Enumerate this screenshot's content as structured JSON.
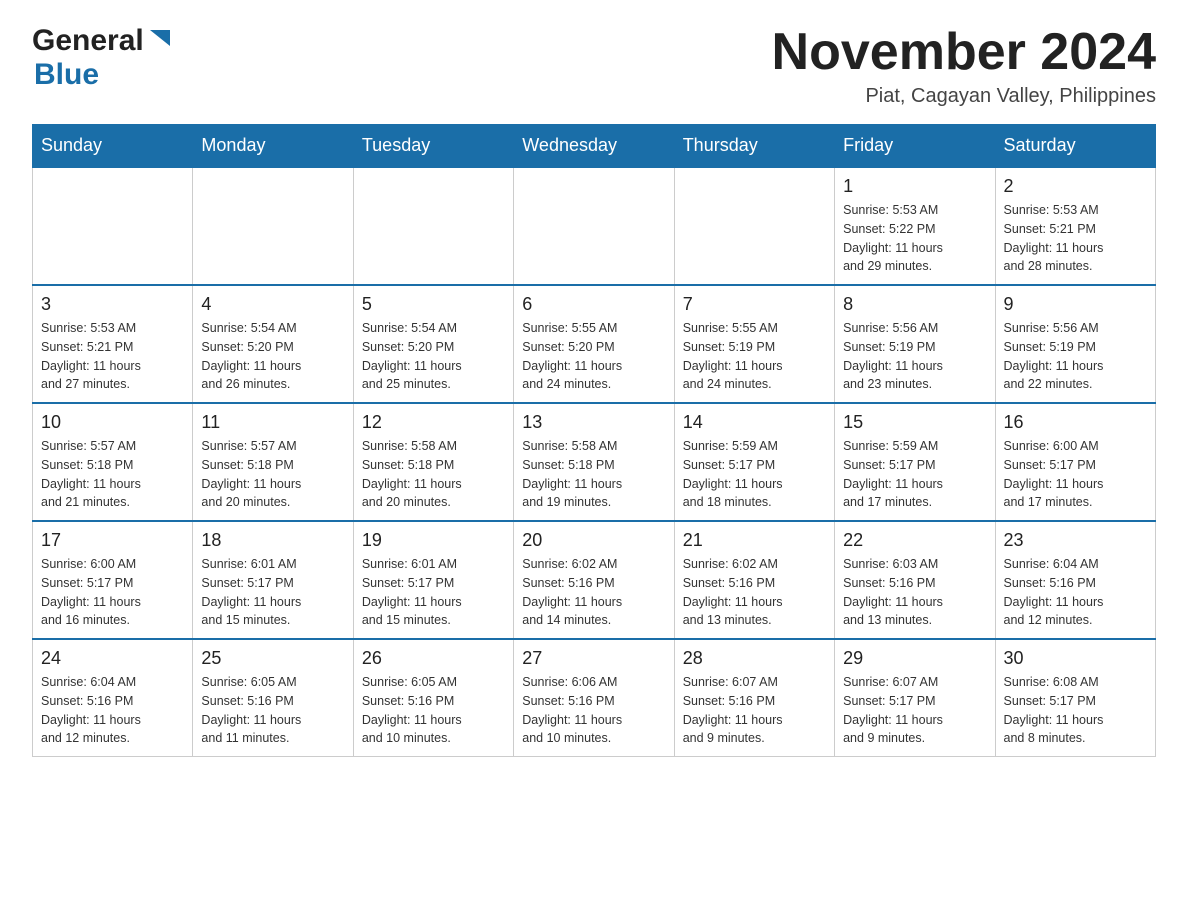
{
  "logo": {
    "general": "General",
    "blue": "Blue",
    "arrow_color": "#1a6ea8"
  },
  "title": "November 2024",
  "subtitle": "Piat, Cagayan Valley, Philippines",
  "weekdays": [
    "Sunday",
    "Monday",
    "Tuesday",
    "Wednesday",
    "Thursday",
    "Friday",
    "Saturday"
  ],
  "weeks": [
    [
      {
        "day": "",
        "info": ""
      },
      {
        "day": "",
        "info": ""
      },
      {
        "day": "",
        "info": ""
      },
      {
        "day": "",
        "info": ""
      },
      {
        "day": "",
        "info": ""
      },
      {
        "day": "1",
        "info": "Sunrise: 5:53 AM\nSunset: 5:22 PM\nDaylight: 11 hours\nand 29 minutes."
      },
      {
        "day": "2",
        "info": "Sunrise: 5:53 AM\nSunset: 5:21 PM\nDaylight: 11 hours\nand 28 minutes."
      }
    ],
    [
      {
        "day": "3",
        "info": "Sunrise: 5:53 AM\nSunset: 5:21 PM\nDaylight: 11 hours\nand 27 minutes."
      },
      {
        "day": "4",
        "info": "Sunrise: 5:54 AM\nSunset: 5:20 PM\nDaylight: 11 hours\nand 26 minutes."
      },
      {
        "day": "5",
        "info": "Sunrise: 5:54 AM\nSunset: 5:20 PM\nDaylight: 11 hours\nand 25 minutes."
      },
      {
        "day": "6",
        "info": "Sunrise: 5:55 AM\nSunset: 5:20 PM\nDaylight: 11 hours\nand 24 minutes."
      },
      {
        "day": "7",
        "info": "Sunrise: 5:55 AM\nSunset: 5:19 PM\nDaylight: 11 hours\nand 24 minutes."
      },
      {
        "day": "8",
        "info": "Sunrise: 5:56 AM\nSunset: 5:19 PM\nDaylight: 11 hours\nand 23 minutes."
      },
      {
        "day": "9",
        "info": "Sunrise: 5:56 AM\nSunset: 5:19 PM\nDaylight: 11 hours\nand 22 minutes."
      }
    ],
    [
      {
        "day": "10",
        "info": "Sunrise: 5:57 AM\nSunset: 5:18 PM\nDaylight: 11 hours\nand 21 minutes."
      },
      {
        "day": "11",
        "info": "Sunrise: 5:57 AM\nSunset: 5:18 PM\nDaylight: 11 hours\nand 20 minutes."
      },
      {
        "day": "12",
        "info": "Sunrise: 5:58 AM\nSunset: 5:18 PM\nDaylight: 11 hours\nand 20 minutes."
      },
      {
        "day": "13",
        "info": "Sunrise: 5:58 AM\nSunset: 5:18 PM\nDaylight: 11 hours\nand 19 minutes."
      },
      {
        "day": "14",
        "info": "Sunrise: 5:59 AM\nSunset: 5:17 PM\nDaylight: 11 hours\nand 18 minutes."
      },
      {
        "day": "15",
        "info": "Sunrise: 5:59 AM\nSunset: 5:17 PM\nDaylight: 11 hours\nand 17 minutes."
      },
      {
        "day": "16",
        "info": "Sunrise: 6:00 AM\nSunset: 5:17 PM\nDaylight: 11 hours\nand 17 minutes."
      }
    ],
    [
      {
        "day": "17",
        "info": "Sunrise: 6:00 AM\nSunset: 5:17 PM\nDaylight: 11 hours\nand 16 minutes."
      },
      {
        "day": "18",
        "info": "Sunrise: 6:01 AM\nSunset: 5:17 PM\nDaylight: 11 hours\nand 15 minutes."
      },
      {
        "day": "19",
        "info": "Sunrise: 6:01 AM\nSunset: 5:17 PM\nDaylight: 11 hours\nand 15 minutes."
      },
      {
        "day": "20",
        "info": "Sunrise: 6:02 AM\nSunset: 5:16 PM\nDaylight: 11 hours\nand 14 minutes."
      },
      {
        "day": "21",
        "info": "Sunrise: 6:02 AM\nSunset: 5:16 PM\nDaylight: 11 hours\nand 13 minutes."
      },
      {
        "day": "22",
        "info": "Sunrise: 6:03 AM\nSunset: 5:16 PM\nDaylight: 11 hours\nand 13 minutes."
      },
      {
        "day": "23",
        "info": "Sunrise: 6:04 AM\nSunset: 5:16 PM\nDaylight: 11 hours\nand 12 minutes."
      }
    ],
    [
      {
        "day": "24",
        "info": "Sunrise: 6:04 AM\nSunset: 5:16 PM\nDaylight: 11 hours\nand 12 minutes."
      },
      {
        "day": "25",
        "info": "Sunrise: 6:05 AM\nSunset: 5:16 PM\nDaylight: 11 hours\nand 11 minutes."
      },
      {
        "day": "26",
        "info": "Sunrise: 6:05 AM\nSunset: 5:16 PM\nDaylight: 11 hours\nand 10 minutes."
      },
      {
        "day": "27",
        "info": "Sunrise: 6:06 AM\nSunset: 5:16 PM\nDaylight: 11 hours\nand 10 minutes."
      },
      {
        "day": "28",
        "info": "Sunrise: 6:07 AM\nSunset: 5:16 PM\nDaylight: 11 hours\nand 9 minutes."
      },
      {
        "day": "29",
        "info": "Sunrise: 6:07 AM\nSunset: 5:17 PM\nDaylight: 11 hours\nand 9 minutes."
      },
      {
        "day": "30",
        "info": "Sunrise: 6:08 AM\nSunset: 5:17 PM\nDaylight: 11 hours\nand 8 minutes."
      }
    ]
  ]
}
